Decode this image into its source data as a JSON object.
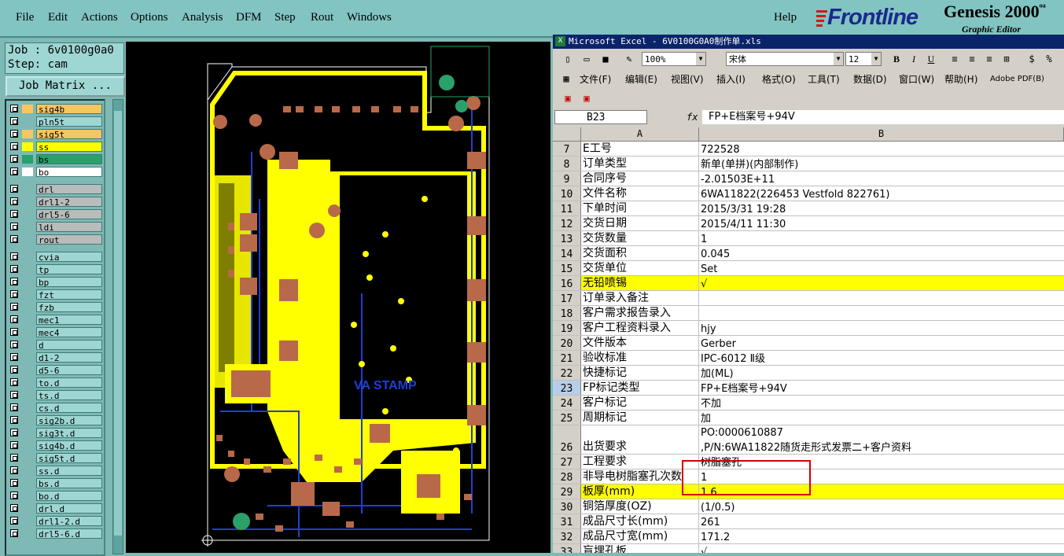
{
  "menu": {
    "items": [
      "File",
      "Edit",
      "Actions",
      "Options",
      "Analysis",
      "DFM",
      "Step",
      "Rout",
      "Windows"
    ],
    "help": "Help"
  },
  "logo": {
    "brand": "Frontline",
    "product": "Genesis 2000",
    "product_suffix": "ᵒᵃ",
    "sub": "Graphic Editor"
  },
  "job": {
    "job_line": "Job : 6v0100g0a0",
    "step_line": "Step: cam",
    "matrix_button": "Job Matrix ..."
  },
  "layers": [
    {
      "name": "sig4b",
      "color": "#f7c561",
      "swatch": "#f7c561"
    },
    {
      "name": "pln5t",
      "color": "#9ed6d3",
      "swatch": ""
    },
    {
      "name": "sig5t",
      "color": "#f7c561",
      "swatch": "#f7c561"
    },
    {
      "name": "ss",
      "color": "#ffff00",
      "swatch": "#ffff00"
    },
    {
      "name": "bs",
      "color": "#2aa06a",
      "swatch": "#2aa06a"
    },
    {
      "name": "bo",
      "color": "#ffffff",
      "swatch": "#ffffff"
    },
    {
      "name": "drl",
      "color": "#b8bcbc",
      "swatch": ""
    },
    {
      "name": "drl1-2",
      "color": "#b8bcbc",
      "swatch": ""
    },
    {
      "name": "drl5-6",
      "color": "#b8bcbc",
      "swatch": ""
    },
    {
      "name": "ldi",
      "color": "#b8bcbc",
      "swatch": ""
    },
    {
      "name": "rout",
      "color": "#b8bcbc",
      "swatch": ""
    },
    {
      "name": "cvia",
      "color": "#9ed6d3",
      "swatch": ""
    },
    {
      "name": "tp",
      "color": "#9ed6d3",
      "swatch": ""
    },
    {
      "name": "bp",
      "color": "#9ed6d3",
      "swatch": ""
    },
    {
      "name": "fzt",
      "color": "#9ed6d3",
      "swatch": ""
    },
    {
      "name": "fzb",
      "color": "#9ed6d3",
      "swatch": ""
    },
    {
      "name": "mec1",
      "color": "#9ed6d3",
      "swatch": ""
    },
    {
      "name": "mec4",
      "color": "#9ed6d3",
      "swatch": ""
    },
    {
      "name": "d",
      "color": "#9ed6d3",
      "swatch": ""
    },
    {
      "name": "d1-2",
      "color": "#9ed6d3",
      "swatch": ""
    },
    {
      "name": "d5-6",
      "color": "#9ed6d3",
      "swatch": ""
    },
    {
      "name": "to.d",
      "color": "#9ed6d3",
      "swatch": ""
    },
    {
      "name": "ts.d",
      "color": "#9ed6d3",
      "swatch": ""
    },
    {
      "name": "cs.d",
      "color": "#9ed6d3",
      "swatch": ""
    },
    {
      "name": "sig2b.d",
      "color": "#9ed6d3",
      "swatch": ""
    },
    {
      "name": "sig3t.d",
      "color": "#9ed6d3",
      "swatch": ""
    },
    {
      "name": "sig4b.d",
      "color": "#9ed6d3",
      "swatch": ""
    },
    {
      "name": "sig5t.d",
      "color": "#9ed6d3",
      "swatch": ""
    },
    {
      "name": "ss.d",
      "color": "#9ed6d3",
      "swatch": ""
    },
    {
      "name": "bs.d",
      "color": "#9ed6d3",
      "swatch": ""
    },
    {
      "name": "bo.d",
      "color": "#9ed6d3",
      "swatch": ""
    },
    {
      "name": "drl.d",
      "color": "#9ed6d3",
      "swatch": ""
    },
    {
      "name": "drl1-2.d",
      "color": "#9ed6d3",
      "swatch": ""
    },
    {
      "name": "drl5-6.d",
      "color": "#9ed6d3",
      "swatch": ""
    }
  ],
  "pcb": {
    "silk_text": "VA STAMP"
  },
  "excel": {
    "title": "Microsoft Excel - 6V0100G0A0制作单.xls",
    "zoom": "100%",
    "font": "宋体",
    "font_size": "12",
    "menus": [
      "文件(F)",
      "编辑(E)",
      "视图(V)",
      "插入(I)",
      "格式(O)",
      "工具(T)",
      "数据(D)",
      "窗口(W)",
      "帮助(H)",
      "Adobe PDF(B)"
    ],
    "name_box": "B23",
    "fx": "fx",
    "formula": "FP+E档案号+94V",
    "col_headers": [
      "A",
      "B"
    ],
    "rows": [
      {
        "n": "7",
        "a": "E工号",
        "b": "722528"
      },
      {
        "n": "8",
        "a": "订单类型",
        "b": "新单(单拼)(内部制作)"
      },
      {
        "n": "9",
        "a": "合同序号",
        "b": "-2.01503E+11"
      },
      {
        "n": "10",
        "a": "文件名称",
        "b": "6WA11822(226453 Vestfold 822761)"
      },
      {
        "n": "11",
        "a": "下单时间",
        "b": "2015/3/31 19:28"
      },
      {
        "n": "12",
        "a": "交货日期",
        "b": "2015/4/11 11:30"
      },
      {
        "n": "13",
        "a": "交货数量",
        "b": "1"
      },
      {
        "n": "14",
        "a": "交货面积",
        "b": "0.045"
      },
      {
        "n": "15",
        "a": "交货单位",
        "b": "Set"
      },
      {
        "n": "16",
        "a": "无铅喷锡",
        "b": "√",
        "yellow": true
      },
      {
        "n": "17",
        "a": "订单录入备注",
        "b": ""
      },
      {
        "n": "18",
        "a": "客户需求报告录入",
        "b": ""
      },
      {
        "n": "19",
        "a": "客户工程资料录入",
        "b": "hjy"
      },
      {
        "n": "20",
        "a": "文件版本",
        "b": "Gerber"
      },
      {
        "n": "21",
        "a": "验收标准",
        "b": "IPC-6012 Ⅱ级"
      },
      {
        "n": "22",
        "a": "快捷标记",
        "b": "加(ML)"
      },
      {
        "n": "23",
        "a": "FP标记类型",
        "b": "FP+E档案号+94V",
        "active": true
      },
      {
        "n": "24",
        "a": "客户标记",
        "b": "不加"
      },
      {
        "n": "25",
        "a": "周期标记",
        "b": "加"
      },
      {
        "n": "26",
        "a": "出货要求",
        "b": "PO:0000610887",
        "b2": ",P/N:6WA11822随货走形式发票二+客户资料",
        "tall": true
      },
      {
        "n": "27",
        "a": "工程要求",
        "b": "树脂塞孔"
      },
      {
        "n": "28",
        "a": "非导电树脂塞孔次数",
        "b": "1"
      },
      {
        "n": "29",
        "a": "板厚(mm)",
        "b": "1.6",
        "yellow": true
      },
      {
        "n": "30",
        "a": "铜箔厚度(OZ)",
        "b": " (1/0.5)"
      },
      {
        "n": "31",
        "a": "成品尺寸长(mm)",
        "b": "261"
      },
      {
        "n": "32",
        "a": "成品尺寸宽(mm)",
        "b": "171.2"
      },
      {
        "n": "33",
        "a": "盲埋孔板",
        "b": "√"
      }
    ]
  }
}
